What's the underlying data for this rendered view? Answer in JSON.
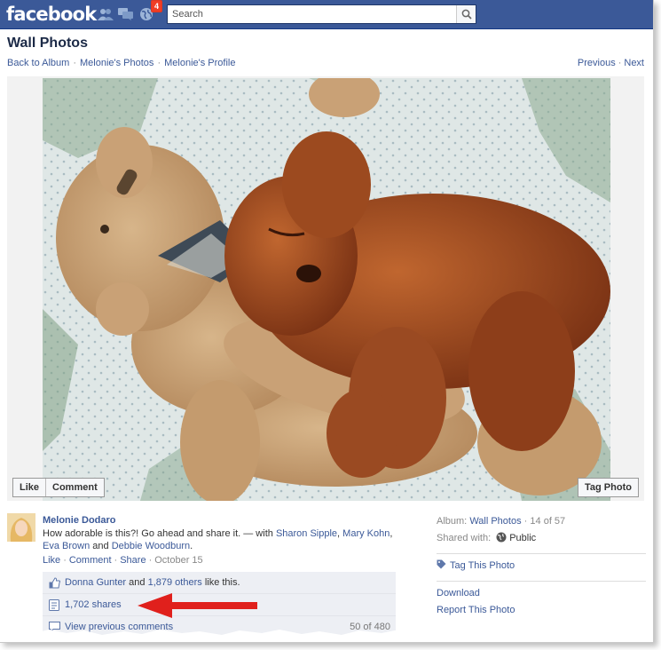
{
  "header": {
    "logo_text": "facebook",
    "notification_count": "4",
    "search_placeholder": "Search",
    "brand_color": "#3b5998"
  },
  "page": {
    "title": "Wall Photos",
    "breadcrumb": [
      "Back to Album",
      "Melonie's Photos",
      "Melonie's Profile"
    ],
    "previous_label": "Previous",
    "next_label": "Next"
  },
  "photo": {
    "description": "sleeping-puppy-on-teddy-bear",
    "like_label": "Like",
    "comment_label": "Comment",
    "tag_label": "Tag Photo"
  },
  "post": {
    "author": "Melonie Dodaro",
    "caption": "How adorable is this?! Go ahead and share it. — with",
    "tagged": [
      "Sharon Sipple",
      "Mary Kohn",
      "Eva Brown"
    ],
    "tagged_joiner": "and",
    "tagged_last": "Debbie Woodburn",
    "actions": [
      "Like",
      "Comment",
      "Share"
    ],
    "date": "October 15"
  },
  "ufi": {
    "liker": "Donna Gunter",
    "likes_and": "and",
    "likes_others": "1,879 others",
    "likes_suffix": "like this.",
    "shares": "1,702 shares",
    "view_comments": "View previous comments",
    "comment_count": "50 of 480"
  },
  "sidebar": {
    "album_label": "Album:",
    "album_name": "Wall Photos",
    "album_position": "14 of 57",
    "shared_label": "Shared with:",
    "shared_value": "Public",
    "tag_photo": "Tag This Photo",
    "download": "Download",
    "report": "Report This Photo"
  }
}
